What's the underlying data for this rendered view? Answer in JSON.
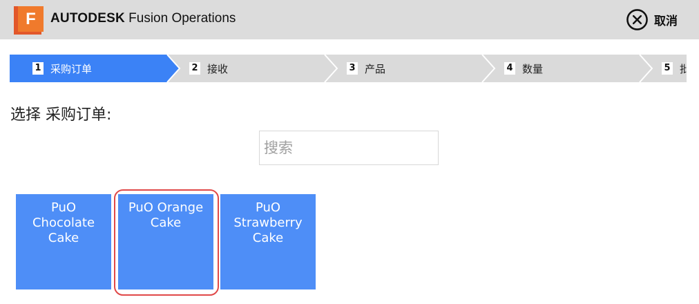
{
  "header": {
    "logo_letter": "F",
    "brand": "AUTODESK",
    "product": "Fusion Operations",
    "cancel_label": "取消",
    "cancel_icon": "close-circle-icon"
  },
  "steps": [
    {
      "num": "1",
      "label": "采购订单",
      "active": true
    },
    {
      "num": "2",
      "label": "接收",
      "active": false
    },
    {
      "num": "3",
      "label": "产品",
      "active": false
    },
    {
      "num": "4",
      "label": "数量",
      "active": false
    },
    {
      "num": "5",
      "label": "批",
      "active": false
    }
  ],
  "colors": {
    "active_step": "#3b82f6",
    "inactive_step": "#dadada",
    "tile": "#4e8ef7",
    "highlight": "#e04848",
    "header_bg": "#dcdcdc"
  },
  "main": {
    "select_label": "选择 采购订单:",
    "search_placeholder": "搜索"
  },
  "tiles": [
    {
      "line1": "PuO",
      "line2": "Chocolate",
      "line3": "Cake"
    },
    {
      "line1": "PuO Orange",
      "line2": "Cake",
      "line3": ""
    },
    {
      "line1": "PuO",
      "line2": "Strawberry",
      "line3": "Cake"
    }
  ]
}
